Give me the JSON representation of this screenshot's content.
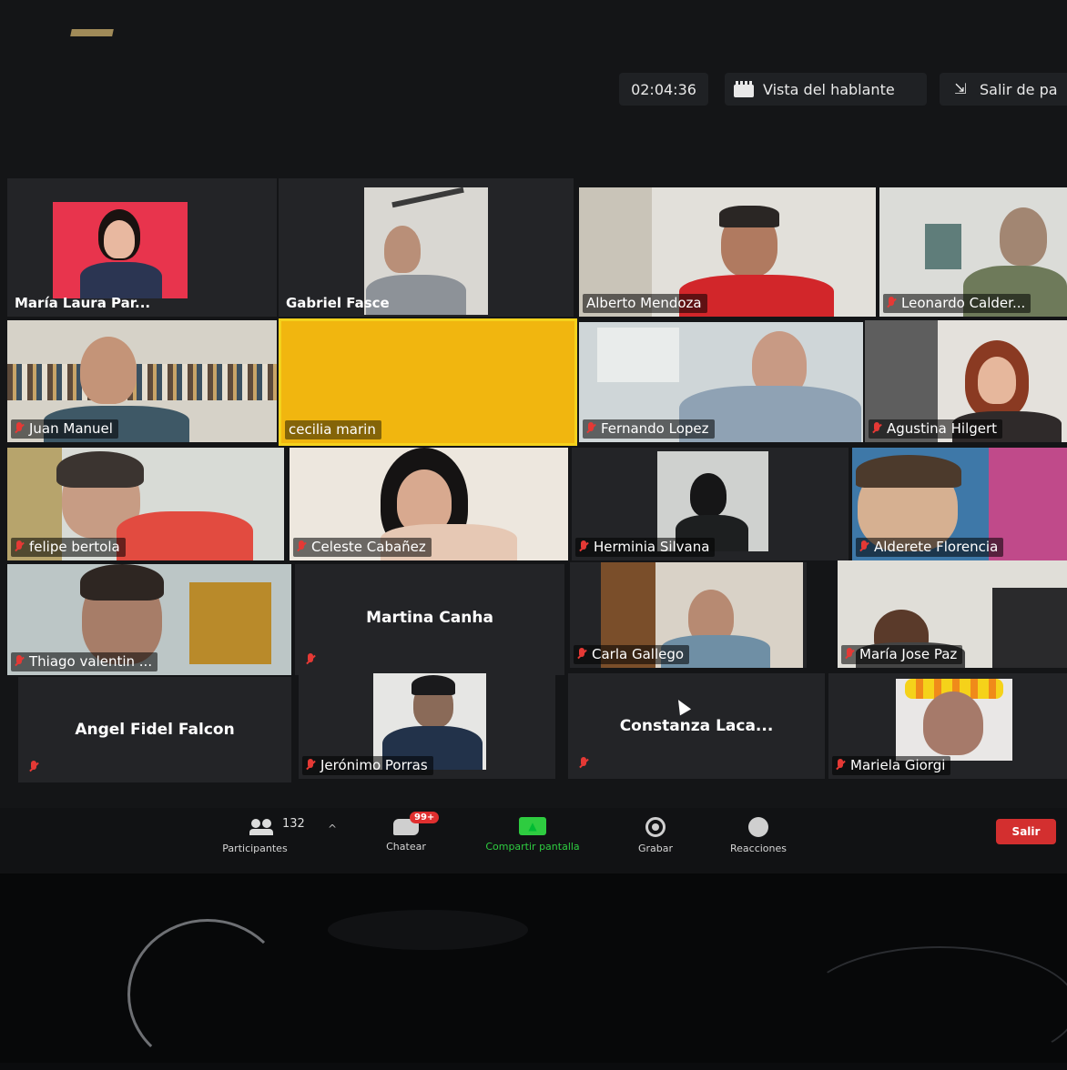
{
  "top_bar": {
    "timer": "02:04:36",
    "speaker_view_label": "Vista del hablante",
    "exit_fullscreen_label": "Salir de pa"
  },
  "participants": [
    {
      "name": "María Laura Par...",
      "muted": false
    },
    {
      "name": "Gabriel Fasce",
      "muted": false
    },
    {
      "name": "Alberto Mendoza",
      "muted": false
    },
    {
      "name": "Leonardo Calder...",
      "muted": true
    },
    {
      "name": "Juan Manuel",
      "muted": true
    },
    {
      "name": "cecilia marin",
      "muted": false,
      "active_speaker": true
    },
    {
      "name": "Fernando Lopez",
      "muted": true
    },
    {
      "name": "Agustina Hilgert",
      "muted": true
    },
    {
      "name": "felipe bertola",
      "muted": true
    },
    {
      "name": "Celeste Cabañez",
      "muted": true
    },
    {
      "name": "Herminia Silvana",
      "muted": true
    },
    {
      "name": "Alderete Florencia",
      "muted": true
    },
    {
      "name": "Thiago valentin ...",
      "muted": true
    },
    {
      "name": "Martina Canha",
      "muted": true,
      "video_off": true
    },
    {
      "name": "Carla Gallego",
      "muted": true
    },
    {
      "name": "María Jose Paz",
      "muted": true
    },
    {
      "name": "Angel Fidel Falcon",
      "muted": true,
      "video_off": true
    },
    {
      "name": "Jerónimo Porras",
      "muted": true
    },
    {
      "name": "Constanza Laca...",
      "muted": true,
      "video_off": true
    },
    {
      "name": "Mariela Giorgi",
      "muted": true
    }
  ],
  "toolbar": {
    "participants_label": "Participantes",
    "participants_count": "132",
    "chat_label": "Chatear",
    "chat_badge": "99+",
    "share_label": "Compartir pantalla",
    "record_label": "Grabar",
    "reactions_label": "Reacciones",
    "leave_label": "Salir"
  },
  "colors": {
    "active_speaker_border": "#f4d21c",
    "share_green": "#2ecc40",
    "leave_red": "#d32f2f",
    "muted_red": "#e53935"
  }
}
